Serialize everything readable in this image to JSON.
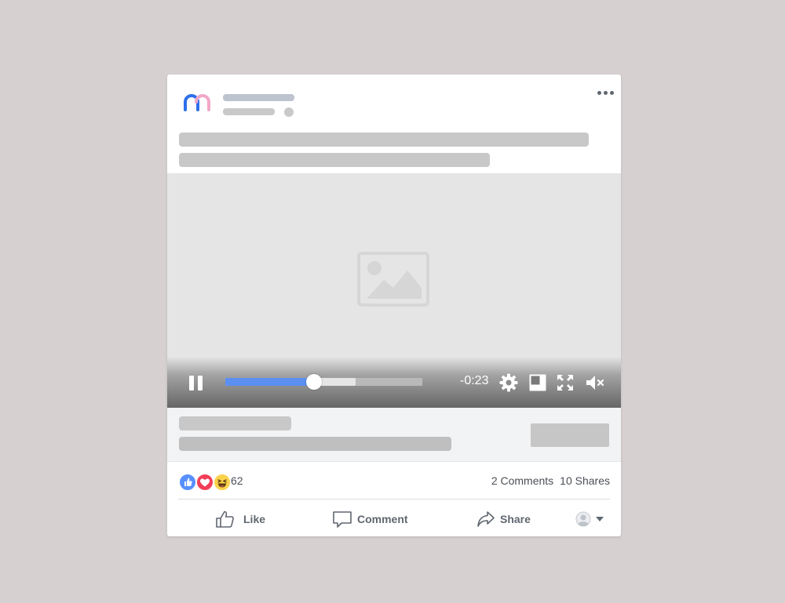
{
  "colors": {
    "background": "#d6d0d0",
    "card": "#ffffff",
    "placeholder_text": "#bec3d0",
    "placeholder_gray": "#c8c8c8",
    "video_bg": "#e5e5e5",
    "progress_played": "#5b8ff1",
    "progress_buffer": "#e6e6e6",
    "logo_blue": "#2f6fea",
    "logo_pink": "#f2a7c8",
    "like_blue": "#5890ff",
    "love_red": "#f33e58",
    "haha_yellow": "#fcd24b"
  },
  "post": {
    "logo_icon": "brand-logo-icon",
    "more_icon": "more-options-icon",
    "media_placeholder_icon": "image-placeholder-icon"
  },
  "video": {
    "play_state_icon": "pause-icon",
    "progress_played": 0.45,
    "progress_buffered": 0.66,
    "time_remaining": "-0:23",
    "icons": [
      "settings-gear-icon",
      "picture-in-picture-icon",
      "fullscreen-icon",
      "volume-muted-icon"
    ]
  },
  "engagement": {
    "reaction_icons": [
      "like-reaction-icon",
      "love-reaction-icon",
      "haha-reaction-icon"
    ],
    "reaction_count": "62",
    "comments": "2 Comments",
    "shares": "10 Shares"
  },
  "actions": {
    "like": "Like",
    "comment": "Comment",
    "share": "Share",
    "audience_icon": "profile-avatar-icon"
  }
}
